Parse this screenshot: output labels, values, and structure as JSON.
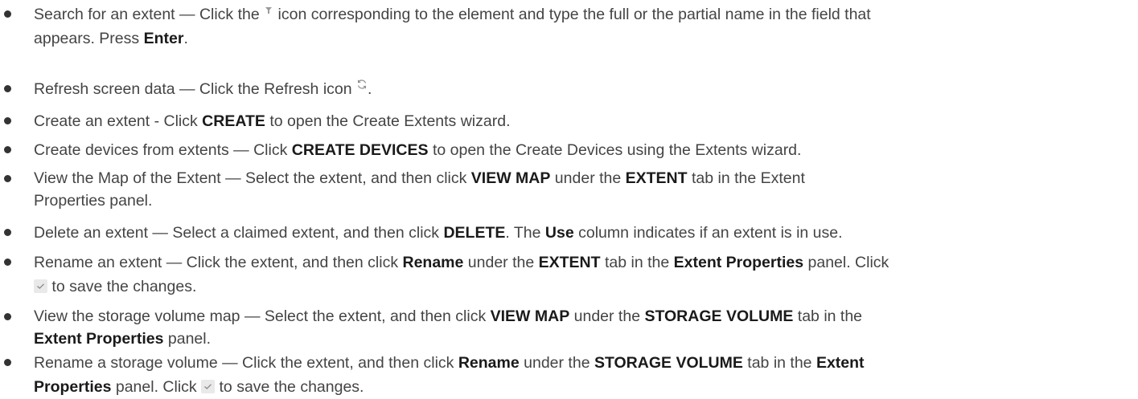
{
  "items": [
    {
      "l1a": "Search for an extent — Click the ",
      "l1b": " icon corresponding to the element and type the full or the partial name in the field that",
      "l2a": "appears. Press ",
      "l2b": "Enter",
      "l2c": ".",
      "icon": "filter-icon"
    },
    {
      "a": "Refresh screen data — Click the Refresh icon ",
      "b": ".",
      "icon": "refresh-icon"
    },
    {
      "a": "Create an extent - Click ",
      "b": "CREATE",
      "c": " to open the Create Extents wizard."
    },
    {
      "a": "Create devices from extents — Click ",
      "b": "CREATE DEVICES",
      "c": " to open the Create Devices using the Extents wizard."
    },
    {
      "a": "View the Map of the Extent — Select the extent, and then click ",
      "b": "VIEW MAP",
      "c": " under the ",
      "d": "EXTENT",
      "e": " tab in the Extent",
      "l2": "Properties panel."
    },
    {
      "a": "Delete an extent — Select a claimed extent, and then click ",
      "b": "DELETE",
      "c": ". The ",
      "d": "Use",
      "e": " column indicates if an extent is in use."
    },
    {
      "a": "Rename an extent — Click the extent, and then click ",
      "b": "Rename",
      "c": " under the ",
      "d": "EXTENT",
      "e": " tab in the ",
      "f": "Extent Properties",
      "g": " panel. Click",
      "l2": " to save the changes.",
      "icon": "checkmark-icon"
    },
    {
      "a": "View the storage volume map — Select the extent, and then click ",
      "b": "VIEW MAP",
      "c": " under the ",
      "d": "STORAGE VOLUME",
      "e": " tab in the",
      "l2a": "Extent Properties",
      "l2b": " panel."
    },
    {
      "a": "Rename a storage volume — Click the extent, and then click ",
      "b": "Rename",
      "c": " under the ",
      "d": "STORAGE VOLUME",
      "e": " tab in the ",
      "f": "Extent",
      "l2a": "Properties",
      "l2b": " panel. Click ",
      "l2c": " to save the changes.",
      "icon": "checkmark-icon"
    }
  ]
}
